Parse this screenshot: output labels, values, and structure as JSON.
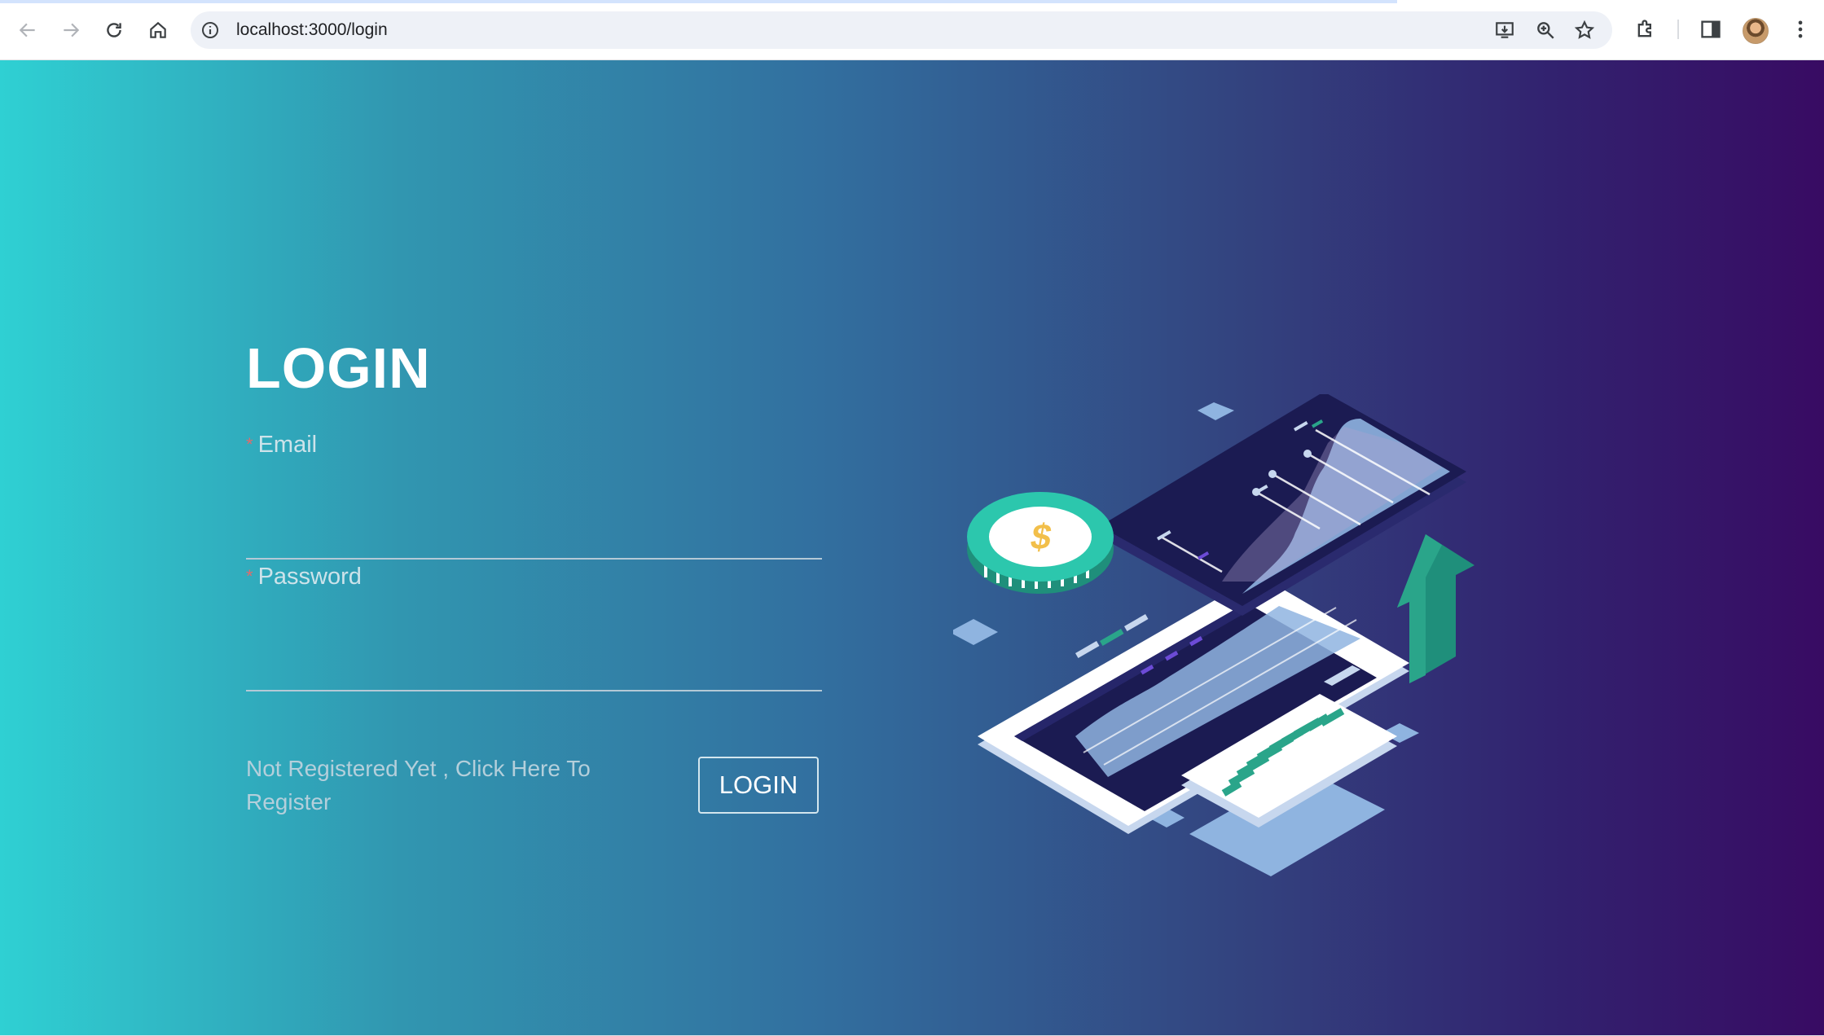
{
  "browser": {
    "url": "localhost:3000/login",
    "icons": [
      "back-icon",
      "forward-icon",
      "reload-icon",
      "home-icon",
      "site-info-icon",
      "install-app-icon",
      "zoom-icon",
      "bookmark-star-icon",
      "extensions-icon",
      "side-panel-icon",
      "profile-avatar",
      "more-menu-icon"
    ]
  },
  "login": {
    "title": "LOGIN",
    "email_label": "Email",
    "password_label": "Password",
    "required_mark": "*",
    "email_value": "",
    "password_value": "",
    "register_text": "Not Registered Yet , Click Here To Register",
    "login_button": "LOGIN"
  },
  "illustration": {
    "icon": "finance-phone-chart-illustration",
    "coin_symbol": "$"
  },
  "colors": {
    "gradient_start": "#2fd0d3",
    "gradient_end": "#380b63",
    "accent_green": "#2aa58a",
    "coin_teal": "#2cc7ad",
    "coin_symbol": "#f2bf4a",
    "chart_light": "#8fb4e0",
    "screen_dark": "#1b1b52"
  }
}
